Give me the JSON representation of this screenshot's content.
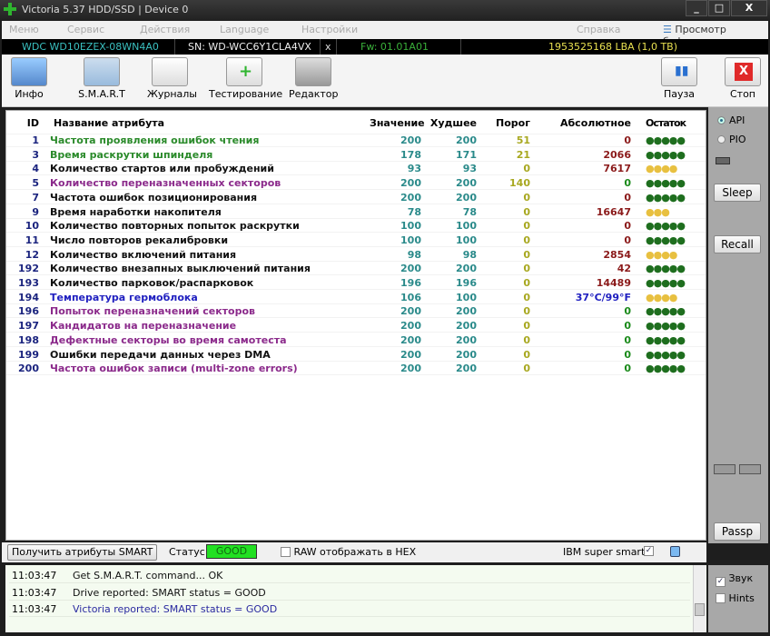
{
  "window": {
    "title": "Victoria 5.37 HDD/SSD | Device 0",
    "min": "_",
    "max": "□",
    "close": "X"
  },
  "menu": {
    "items": [
      "Меню",
      "Сервис",
      "Действия",
      "Language",
      "Настройки"
    ],
    "help": "Справка",
    "buffer": "Просмотр буфера"
  },
  "device": {
    "model": "WDC WD10EZEX-08WN4A0",
    "serial": "SN: WD-WCC6Y1CLA4VX",
    "x": "x",
    "fw": "Fw: 01.01A01",
    "lba": "1953525168 LBA (1,0 TB)"
  },
  "toolbar": {
    "info": "Инфо",
    "smart": "S.M.A.R.T",
    "logs": "Журналы",
    "test": "Тестирование",
    "editor": "Редактор",
    "pause": "Пауза",
    "stop": "Стоп"
  },
  "table": {
    "headers": {
      "id": "ID",
      "name": "Название атрибута",
      "value": "Значение",
      "worst": "Худшее",
      "threshold": "Порог",
      "raw": "Абсолютное",
      "remaining": "Остаток"
    },
    "rows": [
      {
        "id": "1",
        "name": "Частота проявления ошибок чтения",
        "value": "200",
        "worst": "200",
        "threshold": "51",
        "raw": "0",
        "remaining": "●●●●●",
        "name_color": "#2a8a2a",
        "raw_color": "#8b1a1a",
        "rem_color": "#1e6e1e"
      },
      {
        "id": "3",
        "name": "Время раскрутки шпинделя",
        "value": "178",
        "worst": "171",
        "threshold": "21",
        "raw": "2066",
        "remaining": "●●●●●",
        "name_color": "#2a8a2a",
        "raw_color": "#8b1a1a",
        "rem_color": "#1e6e1e"
      },
      {
        "id": "4",
        "name": "Количество стартов или пробуждений",
        "value": "93",
        "worst": "93",
        "threshold": "0",
        "raw": "7617",
        "remaining": "●●●●",
        "name_color": "#111",
        "raw_color": "#8b1a1a",
        "rem_color": "#e8c040"
      },
      {
        "id": "5",
        "name": "Количество переназначенных секторов",
        "value": "200",
        "worst": "200",
        "threshold": "140",
        "raw": "0",
        "remaining": "●●●●●",
        "name_color": "#8b2a8b",
        "raw_color": "#1a8a1a",
        "rem_color": "#1e6e1e"
      },
      {
        "id": "7",
        "name": "Частота ошибок позиционирования",
        "value": "200",
        "worst": "200",
        "threshold": "0",
        "raw": "0",
        "remaining": "●●●●●",
        "name_color": "#111",
        "raw_color": "#8b1a1a",
        "rem_color": "#1e6e1e"
      },
      {
        "id": "9",
        "name": "Время наработки накопителя",
        "value": "78",
        "worst": "78",
        "threshold": "0",
        "raw": "16647",
        "remaining": "●●●",
        "name_color": "#111",
        "raw_color": "#8b1a1a",
        "rem_color": "#e8c040"
      },
      {
        "id": "10",
        "name": "Количество повторных попыток раскрутки",
        "value": "100",
        "worst": "100",
        "threshold": "0",
        "raw": "0",
        "remaining": "●●●●●",
        "name_color": "#111",
        "raw_color": "#8b1a1a",
        "rem_color": "#1e6e1e"
      },
      {
        "id": "11",
        "name": "Число повторов рекалибровки",
        "value": "100",
        "worst": "100",
        "threshold": "0",
        "raw": "0",
        "remaining": "●●●●●",
        "name_color": "#111",
        "raw_color": "#8b1a1a",
        "rem_color": "#1e6e1e"
      },
      {
        "id": "12",
        "name": "Количество включений питания",
        "value": "98",
        "worst": "98",
        "threshold": "0",
        "raw": "2854",
        "remaining": "●●●●",
        "name_color": "#111",
        "raw_color": "#8b1a1a",
        "rem_color": "#e8c040"
      },
      {
        "id": "192",
        "name": "Количество внезапных выключений питания",
        "value": "200",
        "worst": "200",
        "threshold": "0",
        "raw": "42",
        "remaining": "●●●●●",
        "name_color": "#111",
        "raw_color": "#8b1a1a",
        "rem_color": "#1e6e1e"
      },
      {
        "id": "193",
        "name": "Количество парковок/распарковок",
        "value": "196",
        "worst": "196",
        "threshold": "0",
        "raw": "14489",
        "remaining": "●●●●●",
        "name_color": "#111",
        "raw_color": "#8b1a1a",
        "rem_color": "#1e6e1e"
      },
      {
        "id": "194",
        "name": "Температура гермоблока",
        "value": "106",
        "worst": "100",
        "threshold": "0",
        "raw": "37°C/99°F",
        "remaining": "●●●●",
        "name_color": "#2020c0",
        "raw_color": "#2020c0",
        "rem_color": "#e8c040"
      },
      {
        "id": "196",
        "name": "Попыток переназначений секторов",
        "value": "200",
        "worst": "200",
        "threshold": "0",
        "raw": "0",
        "remaining": "●●●●●",
        "name_color": "#8b2a8b",
        "raw_color": "#1a8a1a",
        "rem_color": "#1e6e1e"
      },
      {
        "id": "197",
        "name": "Кандидатов на переназначение",
        "value": "200",
        "worst": "200",
        "threshold": "0",
        "raw": "0",
        "remaining": "●●●●●",
        "name_color": "#8b2a8b",
        "raw_color": "#1a8a1a",
        "rem_color": "#1e6e1e"
      },
      {
        "id": "198",
        "name": "Дефектные секторы во время самотеста",
        "value": "200",
        "worst": "200",
        "threshold": "0",
        "raw": "0",
        "remaining": "●●●●●",
        "name_color": "#8b2a8b",
        "raw_color": "#1a8a1a",
        "rem_color": "#1e6e1e"
      },
      {
        "id": "199",
        "name": "Ошибки передачи данных через DMA",
        "value": "200",
        "worst": "200",
        "threshold": "0",
        "raw": "0",
        "remaining": "●●●●●",
        "name_color": "#111",
        "raw_color": "#1a8a1a",
        "rem_color": "#1e6e1e"
      },
      {
        "id": "200",
        "name": "Частота ошибок записи (multi-zone errors)",
        "value": "200",
        "worst": "200",
        "threshold": "0",
        "raw": "0",
        "remaining": "●●●●●",
        "name_color": "#8b2a8b",
        "raw_color": "#1a8a1a",
        "rem_color": "#1e6e1e"
      }
    ]
  },
  "right_panel": {
    "api": "API",
    "pio": "PIO",
    "sleep": "Sleep",
    "recall": "Recall",
    "passp": "Passp"
  },
  "bottom": {
    "get_smart": "Получить атрибуты SMART",
    "status_label": "Статус:",
    "status": "GOOD",
    "raw_hex": "RAW отображать в HEX",
    "ibm": "IBM super smart:",
    "check": "✓"
  },
  "log": [
    {
      "time": "11:03:47",
      "msg": "Get S.M.A.R.T. command... OK",
      "color": "#111"
    },
    {
      "time": "11:03:47",
      "msg": "Drive reported: SMART status = GOOD",
      "color": "#111"
    },
    {
      "time": "11:03:47",
      "msg": "Victoria reported: SMART status = GOOD",
      "color": "#2a2aa0"
    }
  ],
  "log_panel": {
    "sound": "Звук",
    "hints": "Hints"
  }
}
